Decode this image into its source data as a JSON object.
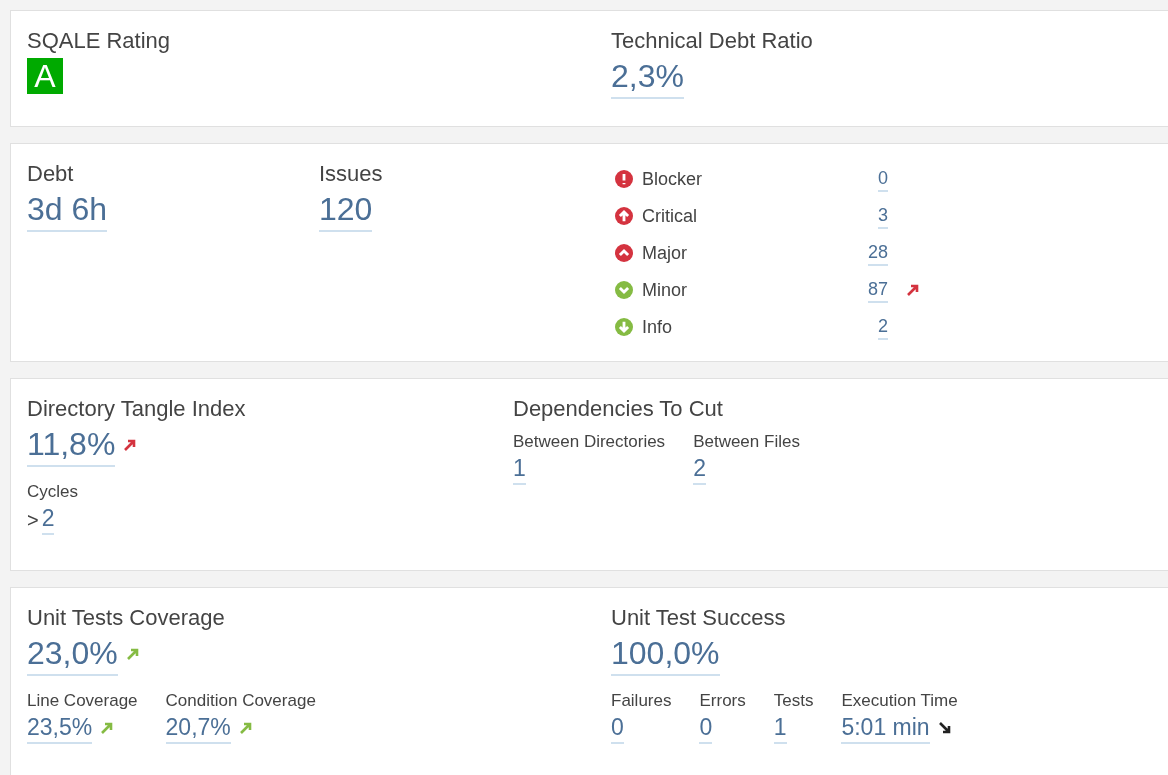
{
  "quality": {
    "sqale_rating": {
      "label": "SQALE Rating",
      "value": "A",
      "color": "#00aa00"
    },
    "debt_ratio": {
      "label": "Technical Debt Ratio",
      "value": "2,3%"
    }
  },
  "issues": {
    "debt": {
      "label": "Debt",
      "value": "3d 6h"
    },
    "count": {
      "label": "Issues",
      "value": "120"
    },
    "severities": [
      {
        "kind": "blocker",
        "label": "Blocker",
        "count": "0",
        "color": "#d4333f"
      },
      {
        "kind": "critical",
        "label": "Critical",
        "count": "3",
        "color": "#d4333f"
      },
      {
        "kind": "major",
        "label": "Major",
        "count": "28",
        "color": "#d4333f"
      },
      {
        "kind": "minor",
        "label": "Minor",
        "count": "87",
        "color": "#85bb43",
        "trend": {
          "kind": "up",
          "color": "#d4333f"
        }
      },
      {
        "kind": "info",
        "label": "Info",
        "count": "2",
        "color": "#85bb43"
      }
    ]
  },
  "design": {
    "tangle": {
      "label": "Directory Tangle Index",
      "value": "11,8%",
      "trend": {
        "kind": "up",
        "color": "#d4333f"
      }
    },
    "cycles": {
      "label": "Cycles",
      "prefix": ">",
      "value": "2"
    },
    "dependencies": {
      "label": "Dependencies To Cut",
      "items": [
        {
          "label": "Between Directories",
          "value": "1"
        },
        {
          "label": "Between Files",
          "value": "2"
        }
      ]
    }
  },
  "tests": {
    "coverage": {
      "label": "Unit Tests Coverage",
      "value": "23,0%",
      "trend": {
        "kind": "up",
        "color": "#85bb43"
      }
    },
    "coverage_details": [
      {
        "label": "Line Coverage",
        "value": "23,5%",
        "trend": {
          "kind": "up",
          "color": "#85bb43"
        }
      },
      {
        "label": "Condition Coverage",
        "value": "20,7%",
        "trend": {
          "kind": "up",
          "color": "#85bb43"
        }
      }
    ],
    "success": {
      "label": "Unit Test Success",
      "value": "100,0%"
    },
    "success_details": [
      {
        "label": "Failures",
        "value": "0"
      },
      {
        "label": "Errors",
        "value": "0"
      },
      {
        "label": "Tests",
        "value": "1"
      },
      {
        "label": "Execution Time",
        "value": "5:01 min",
        "trend": {
          "kind": "down",
          "color": "#222222"
        }
      }
    ]
  }
}
